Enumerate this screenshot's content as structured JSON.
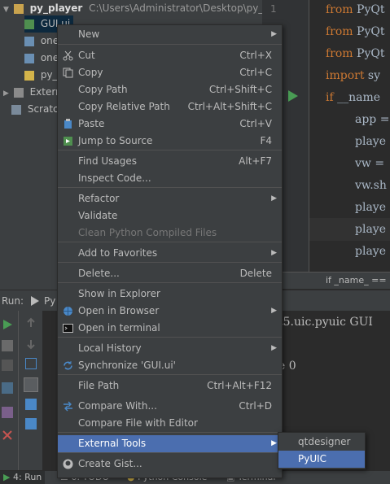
{
  "tree": {
    "root": "py_player",
    "root_path": "C:\\Users\\Administrator\\Desktop\\py_pr",
    "items": [
      "GUI.ui",
      "one",
      "one",
      "py_",
      "Externa",
      "Scratch"
    ]
  },
  "editor": {
    "line_number": "1",
    "lines": [
      {
        "kw": "from",
        "rest": " PyQt"
      },
      {
        "kw": "from",
        "rest": " PyQt"
      },
      {
        "kw": "from",
        "rest": " PyQt"
      },
      {
        "kw": "import",
        "rest": " sy"
      },
      {
        "kw": "if",
        "rest": " __name"
      },
      {
        "kw": "",
        "rest": "app ="
      },
      {
        "kw": "",
        "rest": "playe"
      },
      {
        "kw": "",
        "rest": "vw ="
      },
      {
        "kw": "",
        "rest": "vw.sh"
      },
      {
        "kw": "",
        "rest": "playe"
      },
      {
        "kw": "",
        "rest": "playe"
      },
      {
        "kw": "",
        "rest": "playe"
      }
    ],
    "breadcrumb": "if _name_ =="
  },
  "run": {
    "label": "Run:",
    "tab": "Py",
    "console_lines": [
      "t5.uic.pyuic GUI",
      "",
      "e 0"
    ]
  },
  "status_tabs": [
    "4: Run",
    "6: TODO",
    "Python Console",
    "Terminal"
  ],
  "menu": {
    "items": [
      {
        "label": "New",
        "shortcut": "",
        "submenu": true
      },
      {
        "label": "Cut",
        "shortcut": "Ctrl+X",
        "icon": "cut-icon"
      },
      {
        "label": "Copy",
        "shortcut": "Ctrl+C",
        "icon": "copy-icon"
      },
      {
        "label": "Copy Path",
        "shortcut": "Ctrl+Shift+C"
      },
      {
        "label": "Copy Relative Path",
        "shortcut": "Ctrl+Alt+Shift+C"
      },
      {
        "label": "Paste",
        "shortcut": "Ctrl+V",
        "icon": "paste-icon"
      },
      {
        "label": "Jump to Source",
        "shortcut": "F4",
        "icon": "jump-icon"
      },
      {
        "label": "Find Usages",
        "shortcut": "Alt+F7"
      },
      {
        "label": "Inspect Code...",
        "shortcut": ""
      },
      {
        "label": "Refactor",
        "shortcut": "",
        "submenu": true
      },
      {
        "label": "Validate",
        "shortcut": ""
      },
      {
        "label": "Clean Python Compiled Files",
        "shortcut": "",
        "disabled": true
      },
      {
        "label": "Add to Favorites",
        "shortcut": "",
        "submenu": true
      },
      {
        "label": "Delete...",
        "shortcut": "Delete"
      },
      {
        "label": "Show in Explorer",
        "shortcut": ""
      },
      {
        "label": "Open in Browser",
        "shortcut": "",
        "submenu": true,
        "icon": "globe-icon"
      },
      {
        "label": "Open in terminal",
        "shortcut": "",
        "icon": "terminal-icon"
      },
      {
        "label": "Local History",
        "shortcut": "",
        "submenu": true
      },
      {
        "label": "Synchronize 'GUI.ui'",
        "shortcut": "",
        "icon": "sync-icon"
      },
      {
        "label": "File Path",
        "shortcut": "Ctrl+Alt+F12"
      },
      {
        "label": "Compare With...",
        "shortcut": "Ctrl+D",
        "icon": "compare-icon"
      },
      {
        "label": "Compare File with Editor",
        "shortcut": ""
      },
      {
        "label": "External Tools",
        "shortcut": "",
        "submenu": true,
        "selected": true
      },
      {
        "label": "Create Gist...",
        "shortcut": "",
        "icon": "github-icon"
      }
    ]
  },
  "submenu": {
    "items": [
      {
        "label": "qtdesigner"
      },
      {
        "label": "PyUIC",
        "selected": true
      }
    ]
  },
  "colors": {
    "selection": "#4b6eaf",
    "keyword": "#cc7832",
    "panel": "#3c3f41",
    "editor_bg": "#2b2b2b"
  }
}
